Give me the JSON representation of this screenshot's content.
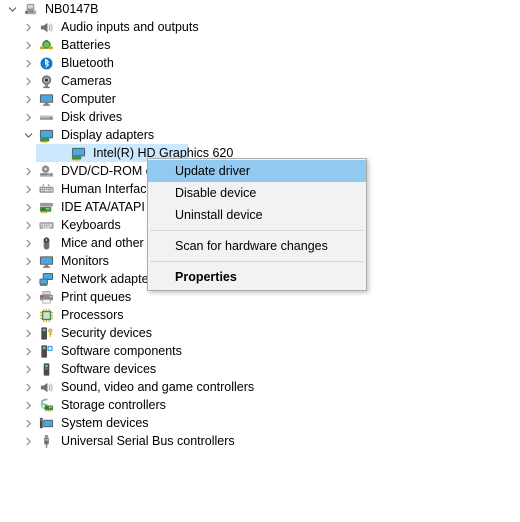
{
  "tree": {
    "root": {
      "label": "NB0147B",
      "icon": "computer-root-icon",
      "expanded": true
    },
    "items": [
      {
        "label": "Audio inputs and outputs",
        "icon": "speaker-icon",
        "expanded": false,
        "level": 1
      },
      {
        "label": "Batteries",
        "icon": "battery-icon",
        "expanded": false,
        "level": 1
      },
      {
        "label": "Bluetooth",
        "icon": "bluetooth-icon",
        "expanded": false,
        "level": 1
      },
      {
        "label": "Cameras",
        "icon": "camera-icon",
        "expanded": false,
        "level": 1
      },
      {
        "label": "Computer",
        "icon": "monitor-icon",
        "expanded": false,
        "level": 1
      },
      {
        "label": "Disk drives",
        "icon": "disk-drive-icon",
        "expanded": false,
        "level": 1
      },
      {
        "label": "Display adapters",
        "icon": "display-adapter-icon",
        "expanded": true,
        "level": 1
      },
      {
        "label": "Intel(R) HD Graphics 620",
        "icon": "display-adapter-icon",
        "expanded": false,
        "level": 2,
        "selected": true
      },
      {
        "label": "DVD/CD-ROM drives",
        "icon": "dvd-drive-icon",
        "expanded": false,
        "level": 1
      },
      {
        "label": "Human Interface Devices",
        "icon": "hid-icon",
        "expanded": false,
        "level": 1
      },
      {
        "label": "IDE ATA/ATAPI controllers",
        "icon": "ide-controller-icon",
        "expanded": false,
        "level": 1
      },
      {
        "label": "Keyboards",
        "icon": "keyboard-icon",
        "expanded": false,
        "level": 1
      },
      {
        "label": "Mice and other pointing devices",
        "icon": "mouse-icon",
        "expanded": false,
        "level": 1
      },
      {
        "label": "Monitors",
        "icon": "monitor-icon",
        "expanded": false,
        "level": 1
      },
      {
        "label": "Network adapters",
        "icon": "network-adapter-icon",
        "expanded": false,
        "level": 1
      },
      {
        "label": "Print queues",
        "icon": "printer-icon",
        "expanded": false,
        "level": 1
      },
      {
        "label": "Processors",
        "icon": "processor-icon",
        "expanded": false,
        "level": 1
      },
      {
        "label": "Security devices",
        "icon": "security-device-icon",
        "expanded": false,
        "level": 1
      },
      {
        "label": "Software components",
        "icon": "software-component-icon",
        "expanded": false,
        "level": 1
      },
      {
        "label": "Software devices",
        "icon": "software-device-icon",
        "expanded": false,
        "level": 1
      },
      {
        "label": "Sound, video and game controllers",
        "icon": "speaker-icon",
        "expanded": false,
        "level": 1
      },
      {
        "label": "Storage controllers",
        "icon": "storage-controller-icon",
        "expanded": false,
        "level": 1
      },
      {
        "label": "System devices",
        "icon": "system-device-icon",
        "expanded": false,
        "level": 1
      },
      {
        "label": "Universal Serial Bus controllers",
        "icon": "usb-icon",
        "expanded": false,
        "level": 1
      }
    ]
  },
  "context_menu": {
    "items": [
      {
        "label": "Update driver",
        "highlighted": true,
        "bold": false
      },
      {
        "label": "Disable device",
        "highlighted": false,
        "bold": false
      },
      {
        "label": "Uninstall device",
        "highlighted": false,
        "bold": false
      },
      {
        "separator": true
      },
      {
        "label": "Scan for hardware changes",
        "highlighted": false,
        "bold": false
      },
      {
        "separator": true
      },
      {
        "label": "Properties",
        "highlighted": false,
        "bold": true
      }
    ]
  },
  "colors": {
    "selection_blue": "#cce8ff",
    "menu_highlight_blue": "#91c9f0",
    "menu_background": "#f2f2f2",
    "menu_border": "#acacac",
    "separator": "#d7d7d7",
    "chevron_gray": "#7a7a7a",
    "text": "#000000"
  }
}
